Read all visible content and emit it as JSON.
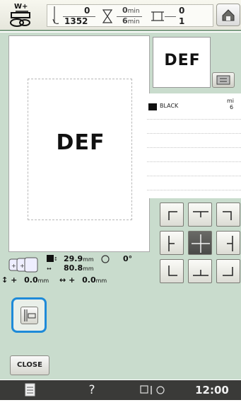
{
  "topbar": {
    "presser_foot_label": "W+",
    "stitch_count": "0",
    "stitch_total": "1352",
    "time_min_top": "0",
    "time_unit_top": "min",
    "time_min_bottom": "6",
    "time_unit_bottom": "min",
    "color_change_current": "0",
    "color_change_total": "1",
    "home_icon": "home-icon"
  },
  "preview": {
    "design_text": "DEF",
    "thumbnail_text": "DEF"
  },
  "size_info": {
    "height_value": "29.9",
    "height_unit": "mm",
    "width_value": "80.8",
    "width_unit": "mm",
    "rotation_value": "0",
    "rotation_unit": "°",
    "vertical_offset": "0.0",
    "vertical_unit": "mm",
    "horizontal_offset": "0.0",
    "horizontal_unit": "mm",
    "plus_v": "+",
    "plus_h": "+"
  },
  "color_list": {
    "color_name": "BLACK",
    "time_label": "mi",
    "time_value": "6",
    "swatch_color": "#111111"
  },
  "direction_grid": {
    "active_index": 4,
    "buttons": [
      "top-left",
      "top-center",
      "top-right",
      "center-left",
      "center",
      "center-right",
      "bottom-left",
      "bottom-center",
      "bottom-right"
    ]
  },
  "lower": {
    "close_label": "CLOSE"
  },
  "bottombar": {
    "help_label": "?",
    "clock": "12:00"
  },
  "colors": {
    "panel_bg": "#c9dccd",
    "highlight": "#1e8ad8",
    "bottom_bar": "#3a3a38"
  }
}
